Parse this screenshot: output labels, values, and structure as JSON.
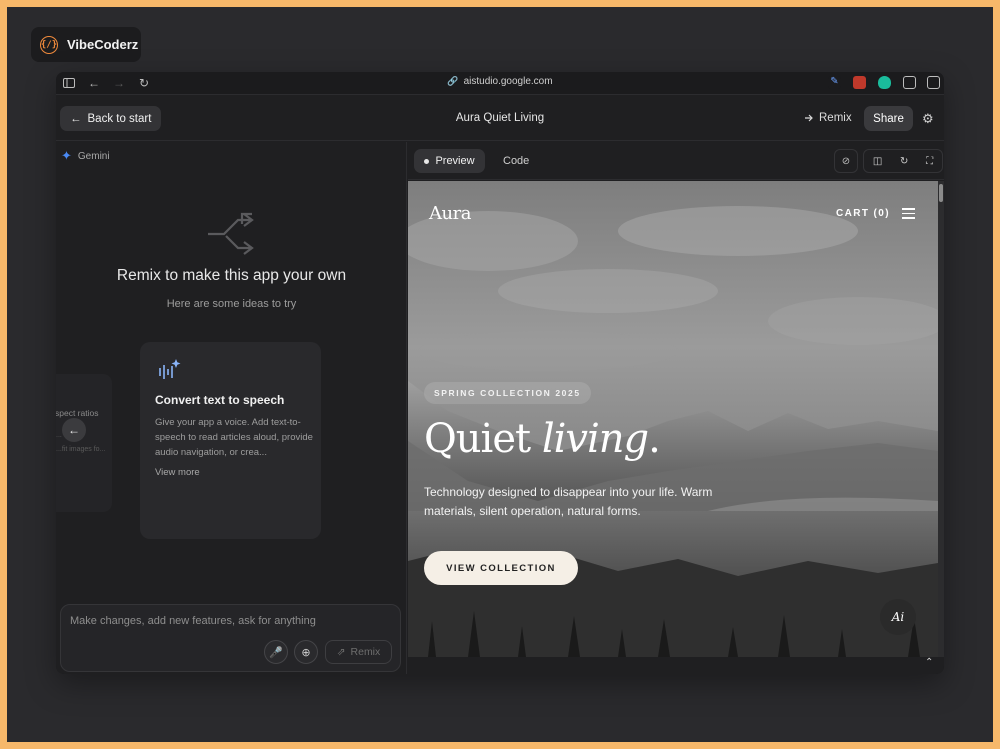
{
  "brand": {
    "name": "VibeCoderz",
    "icon": "curly-braces-bolt-icon",
    "accent": "#f08a3c",
    "frame_color": "#f7b86a"
  },
  "browser": {
    "url": "aistudio.google.com"
  },
  "header": {
    "back_label": "Back to start",
    "title": "Aura Quiet Living",
    "remix_label": "Remix",
    "share_label": "Share"
  },
  "left_panel": {
    "model_label": "Gemini",
    "heading": "Remix to make this app your own",
    "subheading": "Here are some ideas to try",
    "ghost_card": {
      "title": "spect ratios",
      "line1": "...",
      "line2": "...fit images fo..."
    },
    "idea_card": {
      "title": "Convert text to speech",
      "description": "Give your app a voice. Add text-to-speech to read articles aloud, provide audio navigation, or crea...",
      "more_label": "View more"
    },
    "prompt": {
      "placeholder": "Make changes, add new features, ask for anything",
      "send_label": "Remix"
    }
  },
  "right_panel": {
    "tabs": [
      {
        "label": "Preview",
        "active": true
      },
      {
        "label": "Code",
        "active": false
      }
    ]
  },
  "preview": {
    "logo": "Aura",
    "cart_label": "CART (0)",
    "badge": "SPRING COLLECTION 2025",
    "headline_plain": "Quiet ",
    "headline_italic": "living",
    "headline_end": ".",
    "subtext": "Technology designed to disappear into your life. Warm materials, silent operation, natural forms.",
    "cta_label": "VIEW COLLECTION",
    "ai_label": "Ai"
  }
}
